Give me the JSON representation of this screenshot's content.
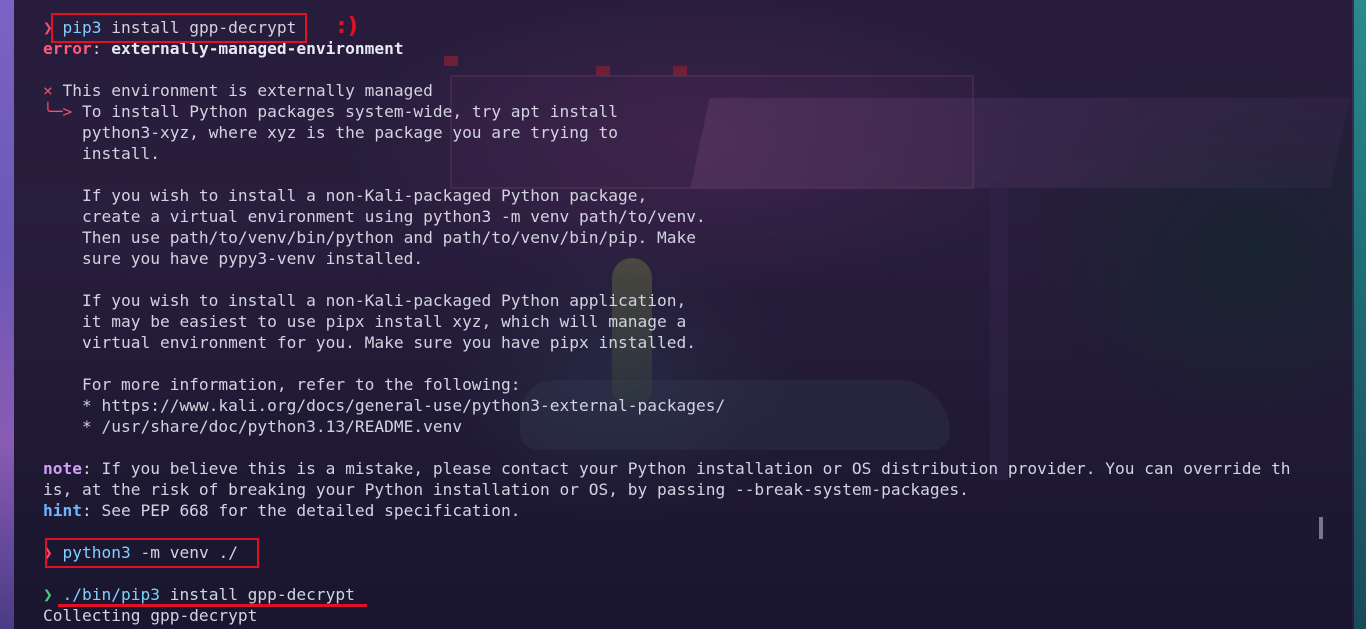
{
  "terminal": {
    "lines": [
      {
        "parts": [
          {
            "cls": "prompt-red",
            "t": "❯ "
          },
          {
            "cls": "cmd",
            "t": "pip3"
          },
          {
            "cls": "",
            "t": " install gpp-decrypt"
          }
        ]
      },
      {
        "parts": [
          {
            "cls": "err",
            "t": "error"
          },
          {
            "cls": "",
            "t": ": "
          },
          {
            "cls": "errmsg",
            "t": "externally-managed-environment"
          }
        ]
      },
      {
        "parts": []
      },
      {
        "parts": [
          {
            "cls": "red",
            "t": "×"
          },
          {
            "cls": "",
            "t": " This environment is externally managed"
          }
        ]
      },
      {
        "parts": [
          {
            "cls": "red",
            "t": "╰─>"
          },
          {
            "cls": "",
            "t": " To install Python packages system-wide, try apt install"
          }
        ]
      },
      {
        "parts": [
          {
            "cls": "",
            "t": "    python3-xyz, where xyz is the package you are trying to"
          }
        ]
      },
      {
        "parts": [
          {
            "cls": "",
            "t": "    install."
          }
        ]
      },
      {
        "parts": []
      },
      {
        "parts": [
          {
            "cls": "",
            "t": "    If you wish to install a non-Kali-packaged Python package,"
          }
        ]
      },
      {
        "parts": [
          {
            "cls": "",
            "t": "    create a virtual environment using python3 -m venv path/to/venv."
          }
        ]
      },
      {
        "parts": [
          {
            "cls": "",
            "t": "    Then use path/to/venv/bin/python and path/to/venv/bin/pip. Make"
          }
        ]
      },
      {
        "parts": [
          {
            "cls": "",
            "t": "    sure you have pypy3-venv installed."
          }
        ]
      },
      {
        "parts": []
      },
      {
        "parts": [
          {
            "cls": "",
            "t": "    If you wish to install a non-Kali-packaged Python application,"
          }
        ]
      },
      {
        "parts": [
          {
            "cls": "",
            "t": "    it may be easiest to use pipx install xyz, which will manage a"
          }
        ]
      },
      {
        "parts": [
          {
            "cls": "",
            "t": "    virtual environment for you. Make sure you have pipx installed."
          }
        ]
      },
      {
        "parts": []
      },
      {
        "parts": [
          {
            "cls": "",
            "t": "    For more information, refer to the following:"
          }
        ]
      },
      {
        "parts": [
          {
            "cls": "",
            "t": "    * https://www.kali.org/docs/general-use/python3-external-packages/"
          }
        ]
      },
      {
        "parts": [
          {
            "cls": "",
            "t": "    * /usr/share/doc/python3.13/README.venv"
          }
        ]
      },
      {
        "parts": []
      },
      {
        "parts": [
          {
            "cls": "note-k",
            "t": "note"
          },
          {
            "cls": "",
            "t": ": If you believe this is a mistake, please contact your Python installation or OS distribution provider. You can override th"
          }
        ]
      },
      {
        "parts": [
          {
            "cls": "",
            "t": "is, at the risk of breaking your Python installation or OS, by passing --break-system-packages."
          }
        ]
      },
      {
        "parts": [
          {
            "cls": "hint-k",
            "t": "hint"
          },
          {
            "cls": "",
            "t": ": See PEP 668 for the detailed specification."
          }
        ]
      },
      {
        "parts": []
      },
      {
        "parts": [
          {
            "cls": "prompt-red",
            "t": "❯ "
          },
          {
            "cls": "cmd",
            "t": "python3"
          },
          {
            "cls": "",
            "t": " -m venv ./"
          }
        ]
      },
      {
        "parts": []
      },
      {
        "parts": [
          {
            "cls": "prompt-green",
            "t": "❯ "
          },
          {
            "cls": "cmd-b",
            "t": "./bin/pip3"
          },
          {
            "cls": "",
            "t": " install gpp-decrypt"
          }
        ]
      },
      {
        "parts": [
          {
            "cls": "",
            "t": "Collecting gpp-decrypt"
          }
        ]
      }
    ]
  },
  "annotations": {
    "smiley": ":)"
  },
  "colors": {
    "annotation_red": "#e01025",
    "error_pink": "#ff5a7d",
    "prompt_green": "#4ec97e",
    "command_blue": "#7ed0ff"
  }
}
